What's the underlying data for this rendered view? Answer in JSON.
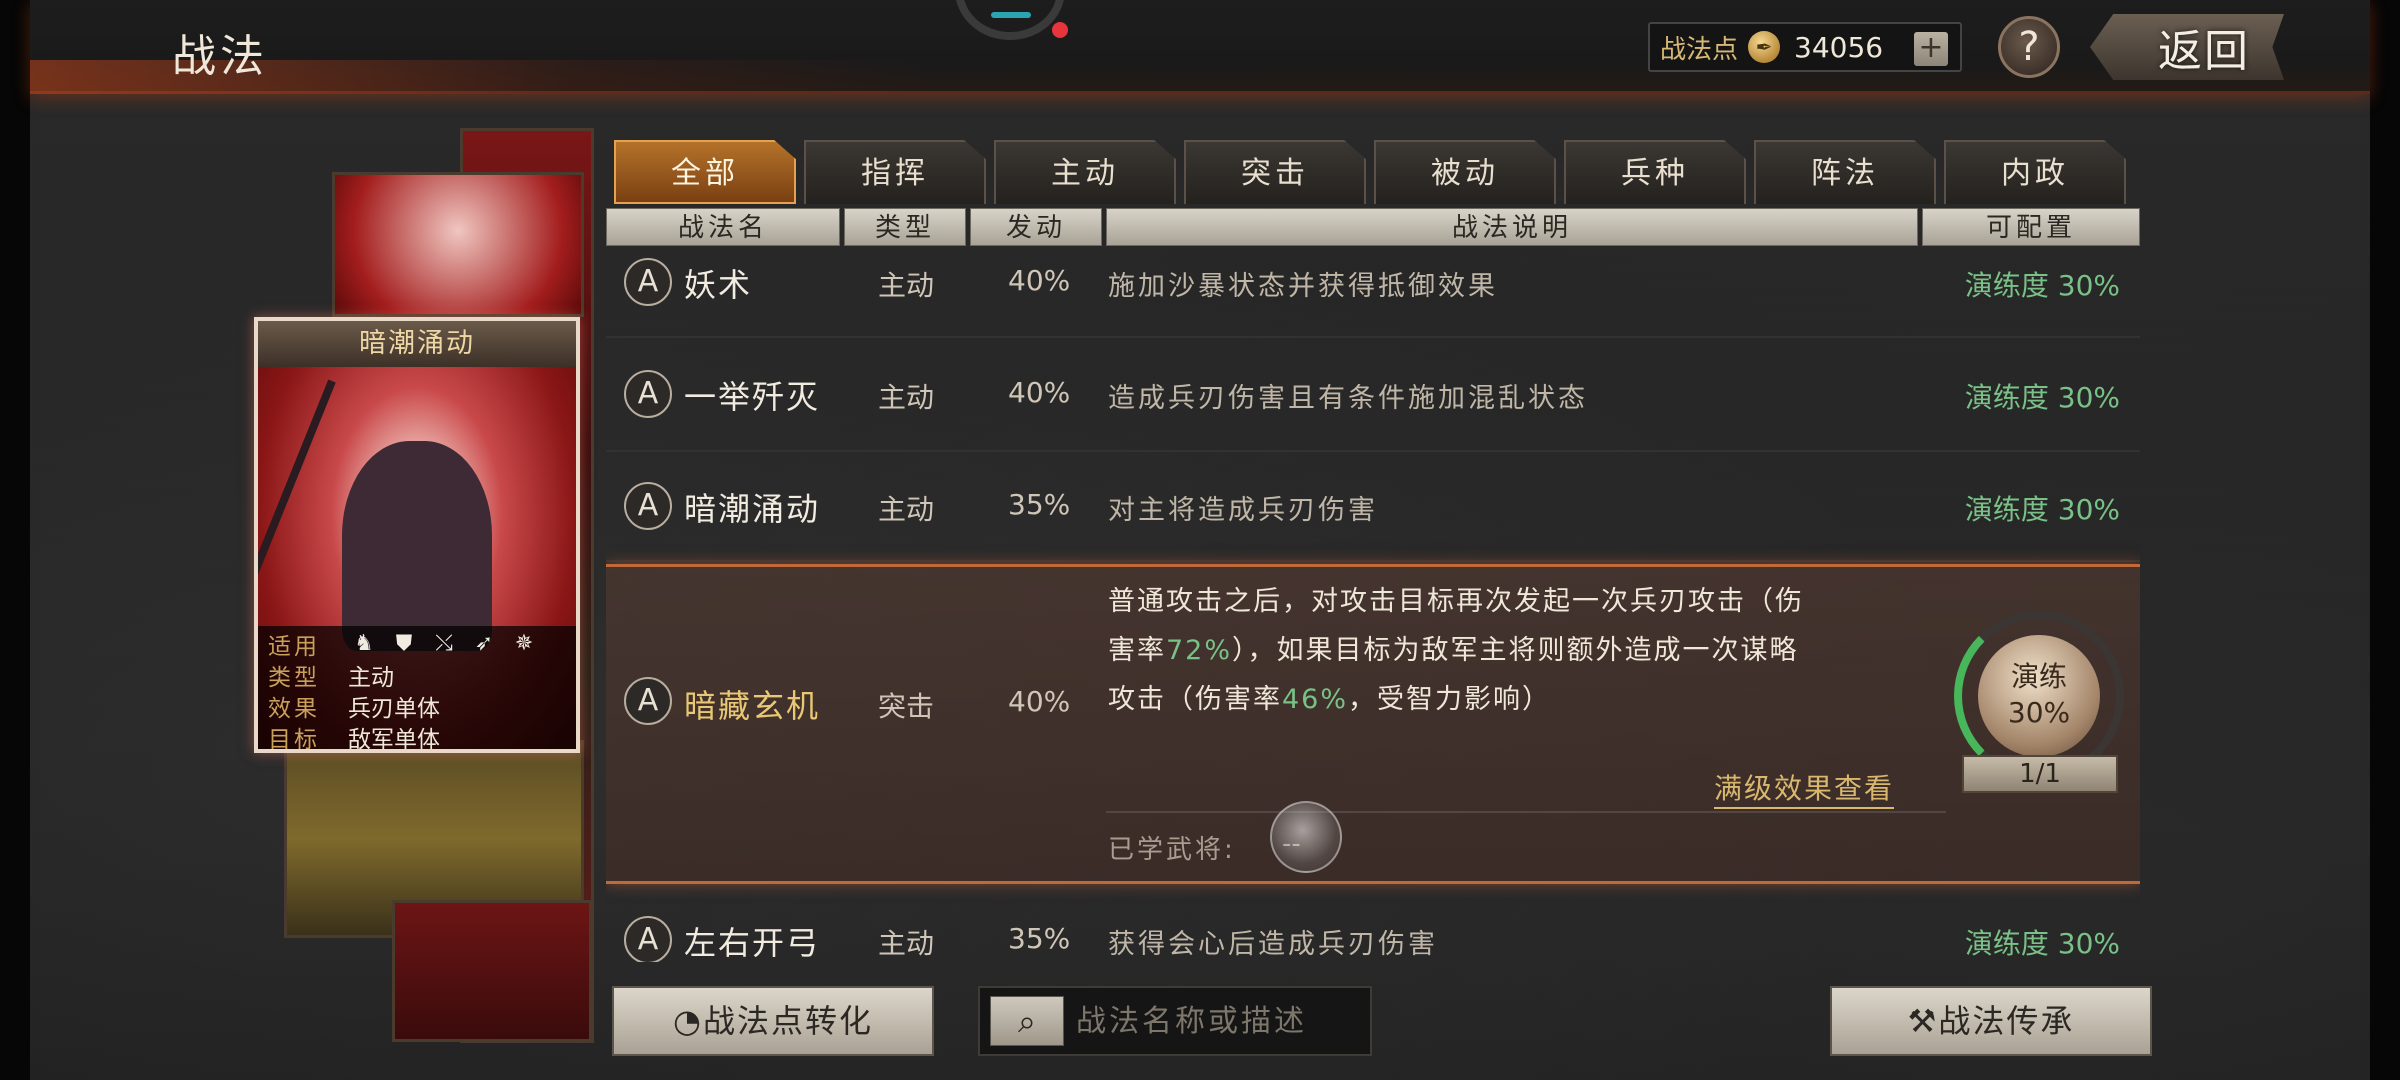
{
  "header": {
    "title": "战法",
    "points_label": "战法点",
    "points_icon": "ink-drop-icon",
    "points_value": "34056",
    "plus_label": "+",
    "help_label": "?",
    "back_label": "返回"
  },
  "card": {
    "title": "暗潮涌动",
    "rows": [
      {
        "key": "适用",
        "value": ""
      },
      {
        "key": "类型",
        "value": "主动"
      },
      {
        "key": "效果",
        "value": "兵刃单体"
      },
      {
        "key": "目标",
        "value": "敌军单体"
      }
    ],
    "troop_icons": [
      "cavalry-icon",
      "shield-icon",
      "bow-icon",
      "spear-icon",
      "wheel-icon"
    ]
  },
  "tabs": [
    "全部",
    "指挥",
    "主动",
    "突击",
    "被动",
    "兵种",
    "阵法",
    "内政"
  ],
  "active_tab": 0,
  "table_headers": {
    "name": "战法名",
    "type": "类型",
    "rate": "发动",
    "desc": "战法说明",
    "config": "可配置"
  },
  "tactics": [
    {
      "grade": "A",
      "name": "妖术",
      "type": "主动",
      "rate": "40%",
      "desc": "施加沙暴状态并获得抵御效果",
      "proficiency": "演练度 30%"
    },
    {
      "grade": "A",
      "name": "一举歼灭",
      "type": "主动",
      "rate": "40%",
      "desc": "造成兵刃伤害且有条件施加混乱状态",
      "proficiency": "演练度 30%"
    },
    {
      "grade": "A",
      "name": "暗潮涌动",
      "type": "主动",
      "rate": "35%",
      "desc": "对主将造成兵刃伤害",
      "proficiency": "演练度 30%"
    },
    {
      "grade": "A",
      "name": "左右开弓",
      "type": "主动",
      "rate": "35%",
      "desc": "获得会心后造成兵刃伤害",
      "proficiency": "演练度 30%"
    }
  ],
  "expanded": {
    "grade": "A",
    "name": "暗藏玄机",
    "type": "突击",
    "rate": "40%",
    "desc_line1": "普通攻击之后，对攻击目标再次发起一次兵刃攻击（伤",
    "desc_line2_a": "害率",
    "desc_line2_hl": "72%",
    "desc_line2_b": "），如果目标为敌军主将则额外造成一次谋略",
    "desc_line3_a": "攻击（伤害率",
    "desc_line3_hl": "46%",
    "desc_line3_b": "，受智力影响）",
    "full_effect_link": "满级效果查看",
    "learned_label": "已学武将:",
    "learned_value": "--",
    "dial_label": "演练",
    "dial_value": "30%",
    "dial_count": "1/1"
  },
  "bottom": {
    "convert_label": "战法点转化",
    "search_icon": "search-icon",
    "search_placeholder": "战法名称或描述",
    "inherit_label": "战法传承"
  },
  "colors": {
    "accent_orange": "#b4722a",
    "proficiency_green": "#79c186",
    "highlight_gold": "#e8c874"
  }
}
